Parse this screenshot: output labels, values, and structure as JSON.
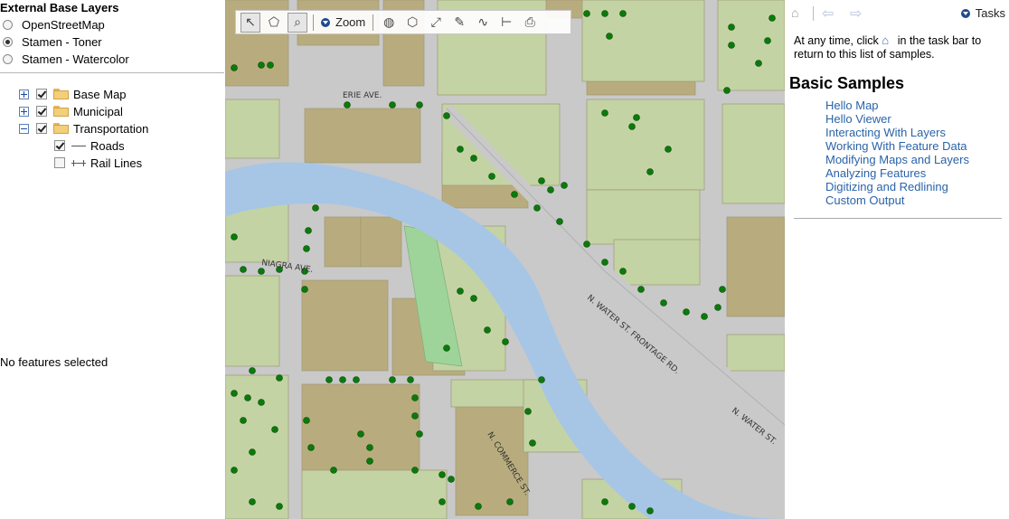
{
  "left_panel": {
    "heading": "External Base Layers",
    "base_layers": [
      {
        "label": "OpenStreetMap",
        "selected": false
      },
      {
        "label": "Stamen - Toner",
        "selected": true
      },
      {
        "label": "Stamen - Watercolor",
        "selected": false
      }
    ],
    "layer_tree": [
      {
        "label": "Base Map",
        "expanded": false,
        "checked": true
      },
      {
        "label": "Municipal",
        "expanded": false,
        "checked": true
      },
      {
        "label": "Transportation",
        "expanded": true,
        "checked": true
      },
      {
        "label": "Roads",
        "checked": true,
        "symbol": "line"
      },
      {
        "label": "Rail Lines",
        "checked": false,
        "symbol": "rail"
      }
    ],
    "selection_status": "No features selected"
  },
  "map": {
    "toolbar": {
      "zoom_label": "Zoom",
      "tools": [
        "select-icon",
        "select-polygon-icon",
        "zoom-box-icon",
        "buffer-icon",
        "select-by-polygon-icon",
        "extent-icon",
        "redline-icon",
        "measure-icon",
        "ruler-icon",
        "print-icon"
      ]
    },
    "street_labels": [
      "ERIE AVE.",
      "NIAGRA AVE.",
      "N. WATER ST. FRONTAGE RD.",
      "N. WATER ST.",
      "N. COMMERCE ST."
    ],
    "colors": {
      "river": "#a7c6e6",
      "street": "#c9c9c9",
      "parcel_tan": "#b8ac7e",
      "parcel_green": "#c4d3a4",
      "park": "#9ed39a",
      "tree": "#0b7a0b"
    }
  },
  "right_panel": {
    "tasks_label": "Tasks",
    "intro_before": "At any time, click",
    "intro_after": "in the task bar to return to this list of samples.",
    "section_title": "Basic Samples",
    "links": [
      "Hello Map",
      "Hello Viewer",
      "Interacting With Layers",
      "Working With Feature Data",
      "Modifying Maps and Layers",
      "Analyzing Features",
      "Digitizing and Redlining",
      "Custom Output"
    ]
  }
}
